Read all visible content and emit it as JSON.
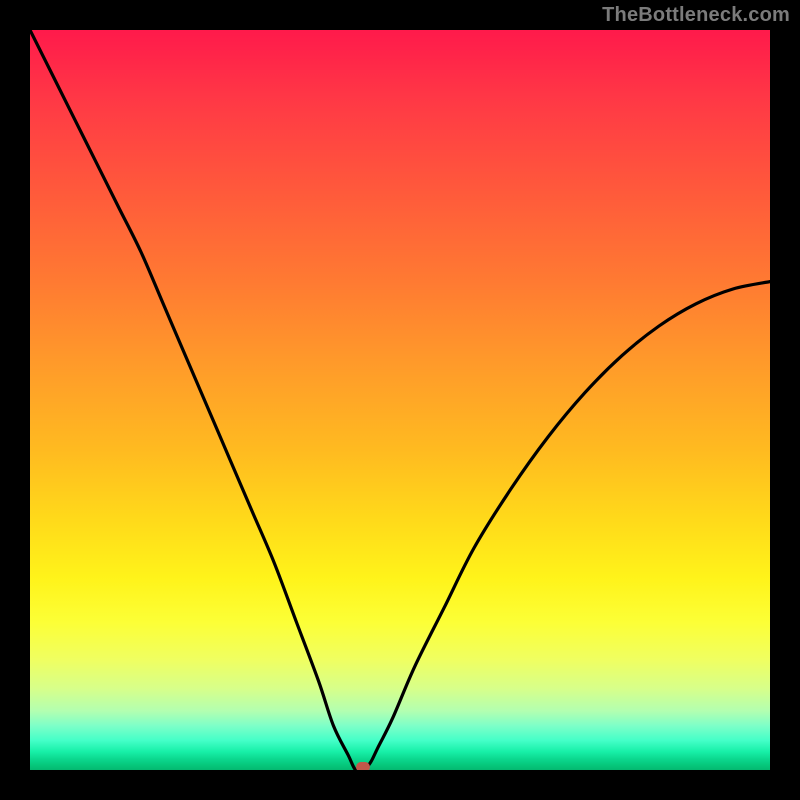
{
  "watermark": "TheBottleneck.com",
  "colors": {
    "frame": "#000000",
    "watermark_text": "#7b7b7b",
    "curve_stroke": "#000000",
    "marker_fill": "#c1574a",
    "gradient_top": "#ff1a4b",
    "gradient_bottom": "#04b870"
  },
  "chart_data": {
    "type": "line",
    "title": "",
    "xlabel": "",
    "ylabel": "",
    "xlim": [
      0,
      100
    ],
    "ylim": [
      0,
      100
    ],
    "grid": false,
    "legend": false,
    "annotations": [
      "TheBottleneck.com"
    ],
    "min_point": {
      "x": 45,
      "y": 0
    },
    "series": [
      {
        "name": "bottleneck-curve",
        "x": [
          0,
          3,
          6,
          9,
          12,
          15,
          18,
          21,
          24,
          27,
          30,
          33,
          36,
          39,
          41,
          43,
          44,
          45,
          46,
          47,
          49,
          52,
          56,
          60,
          65,
          70,
          75,
          80,
          85,
          90,
          95,
          100
        ],
        "y": [
          100,
          94,
          88,
          82,
          76,
          70,
          63,
          56,
          49,
          42,
          35,
          28,
          20,
          12,
          6,
          2,
          0,
          0,
          1,
          3,
          7,
          14,
          22,
          30,
          38,
          45,
          51,
          56,
          60,
          63,
          65,
          66
        ]
      }
    ]
  }
}
